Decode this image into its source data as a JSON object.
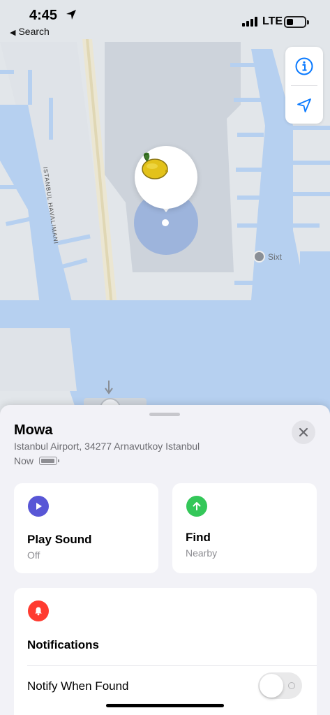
{
  "status_bar": {
    "time": "4:45",
    "back_label": "Search",
    "network": "LTE"
  },
  "map": {
    "road_label": "ISTANBUL HAVALIMANI",
    "poi_label": "Sixt",
    "item_emoji": "🍋",
    "colors": {
      "water": "#b6d0f0",
      "land": "#e2e6ea",
      "building": "#cdd3db",
      "accuracy_circle": "#8caadc"
    }
  },
  "sheet": {
    "item_name": "Mowa",
    "address": "Istanbul Airport, 34277 Arnavutkoy Istanbul",
    "last_seen": "Now",
    "play_sound": {
      "title": "Play Sound",
      "subtitle": "Off",
      "icon": "play-icon",
      "color": "#5856d6"
    },
    "find": {
      "title": "Find",
      "subtitle": "Nearby",
      "icon": "arrow-up-icon",
      "color": "#34c759"
    },
    "notifications": {
      "title": "Notifications",
      "icon": "bell-icon",
      "color": "#ff3b30",
      "notify_when_found_label": "Notify When Found",
      "notify_when_found_on": false
    }
  }
}
